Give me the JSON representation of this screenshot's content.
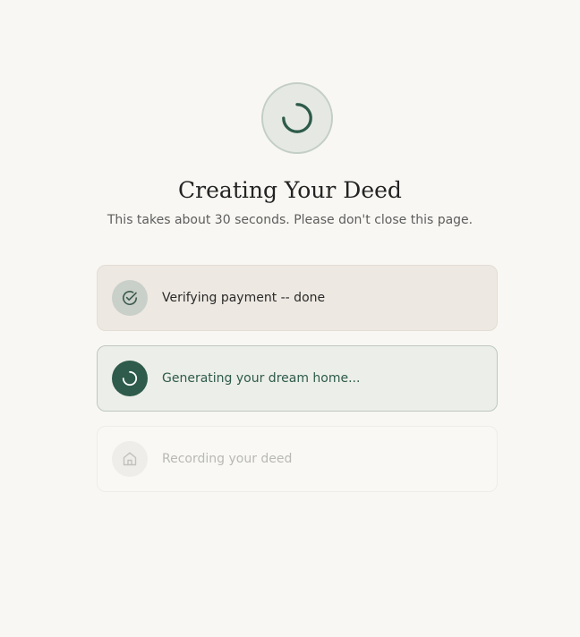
{
  "header": {
    "title": "Creating Your Deed",
    "subtitle": "This takes about 30 seconds. Please don't close this page."
  },
  "icons": {
    "main_spinner": "spinner-icon",
    "step_done": "check-circle-icon",
    "step_active": "spinner-icon",
    "step_pending": "home-icon"
  },
  "steps": [
    {
      "label": "Verifying payment -- done",
      "status": "done"
    },
    {
      "label": "Generating your dream home...",
      "status": "active"
    },
    {
      "label": "Recording your deed",
      "status": "pending"
    }
  ],
  "colors": {
    "background": "#f8f7f3",
    "accent": "#2e5b4b",
    "done_bg": "#ede8e1",
    "active_bg": "#eceee9",
    "pending_text": "#b8b8b4"
  }
}
